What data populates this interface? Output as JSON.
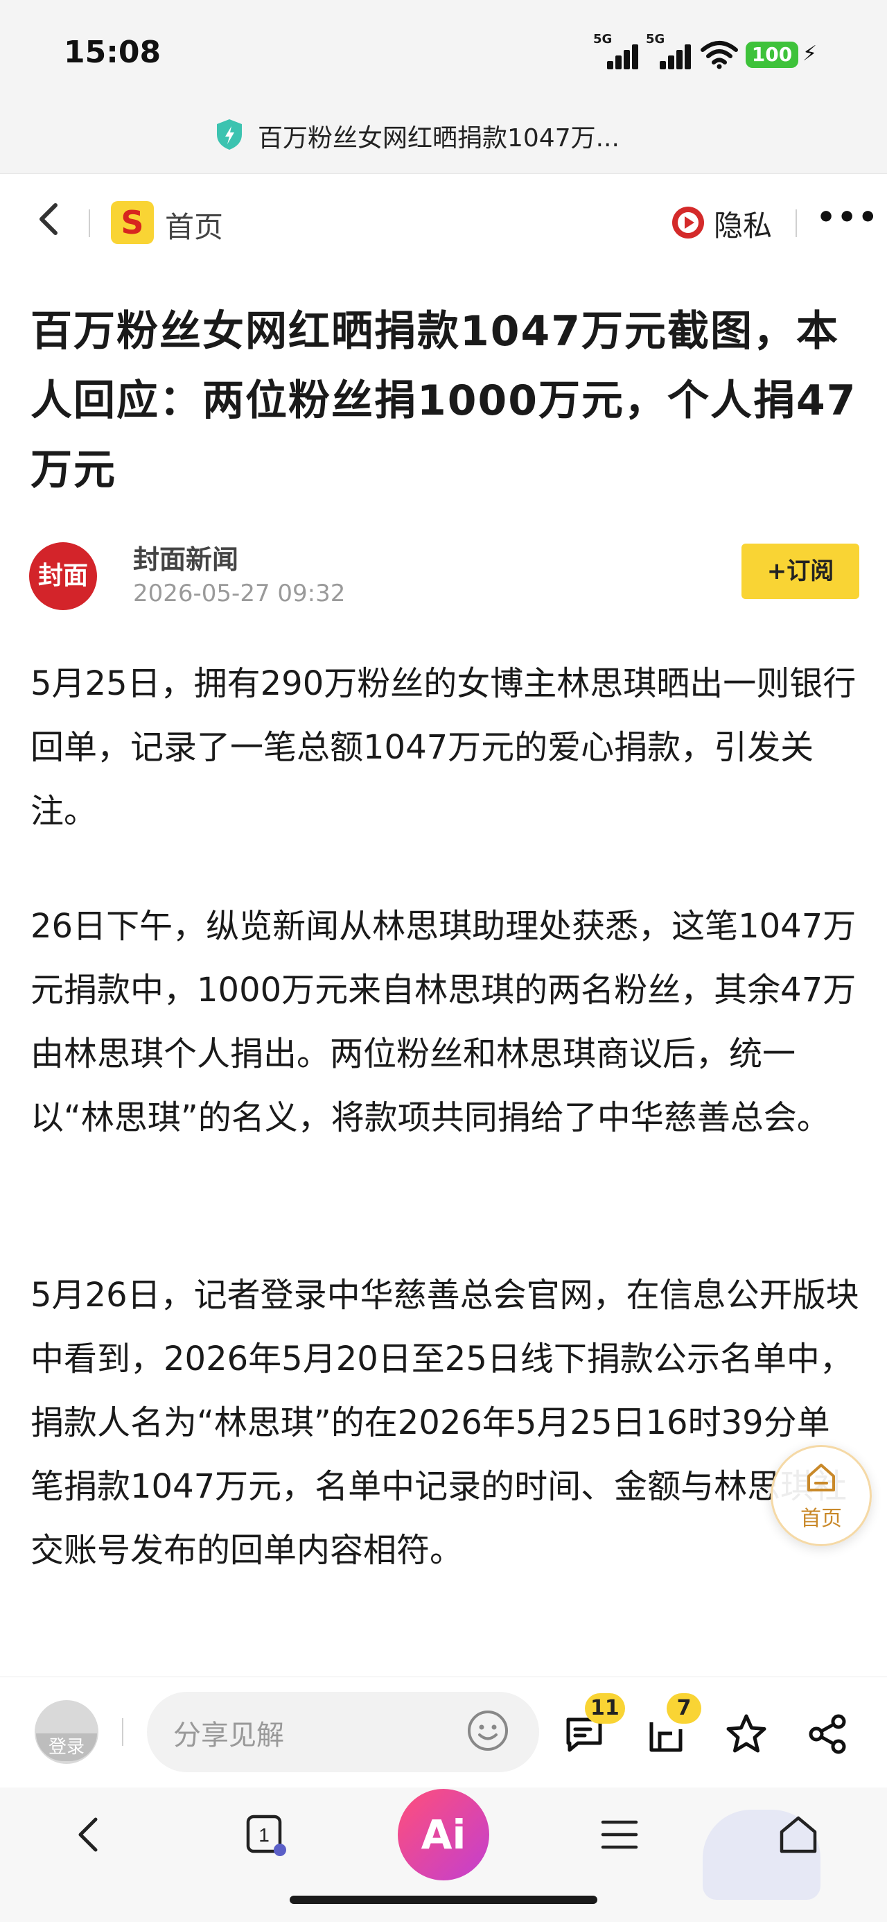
{
  "status_bar": {
    "time": "15:08",
    "signal_1_label": "5G",
    "signal_2_label": "5G",
    "battery": "100"
  },
  "url_bar": {
    "title": "百万粉丝女网红晒捐款1047万..."
  },
  "nav": {
    "home_label": "首页",
    "logo_letter": "S",
    "privacy_label": "隐私",
    "more_label": "•••"
  },
  "article": {
    "headline": "百万粉丝女网红晒捐款1047万元截图，本人回应：两位粉丝捐1000万元，个人捐47万元",
    "source": {
      "avatar_text": "封面",
      "name": "封面新闻",
      "date": "2026-05-27 09:32",
      "subscribe_label": "+订阅"
    },
    "paragraphs": [
      "5月25日，拥有290万粉丝的女博主林思琪晒出一则银行回单，记录了一笔总额1047万元的爱心捐款，引发关注。",
      "26日下午，纵览新闻从林思琪助理处获悉，这笔1047万元捐款中，1000万元来自林思琪的两名粉丝，其余47万由林思琪个人捐出。两位粉丝和林思琪商议后，统一以“林思琪”的名义，将款项共同捐给了中华慈善总会。",
      "5月26日，记者登录中华慈善总会官网，在信息公开版块中看到，2026年5月20日至25日线下捐款公示名单中，捐款人名为“林思琪”的在2026年5月25日16时39分单笔捐款1047万元，名单中记录的时间、金额与林思琪社交账号发布的回单内容相符。"
    ]
  },
  "floating_home": {
    "label": "首页"
  },
  "action_bar": {
    "login_label": "登录",
    "comment_placeholder": "分享见解",
    "comment_count": "11",
    "collect_count": "7"
  },
  "browser_nav": {
    "tab_count": "1",
    "ai_label": "Ai"
  },
  "colors": {
    "accent_yellow": "#f9d434",
    "brand_red": "#d3242a",
    "ai_gradient_start": "#ff4f7a",
    "ai_gradient_end": "#c23fd0"
  }
}
